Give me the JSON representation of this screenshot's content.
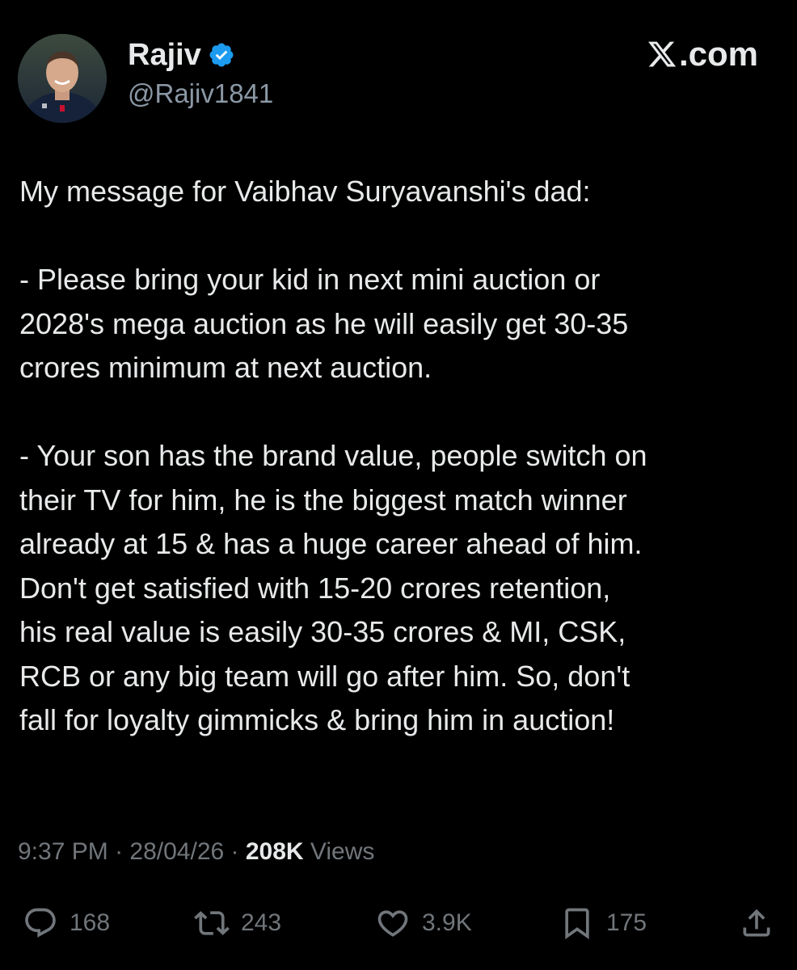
{
  "author": {
    "display_name": "Rajiv",
    "handle": "@Rajiv1841",
    "verified": true
  },
  "brand": {
    "label": ".com"
  },
  "tweet": {
    "text": "My message for Vaibhav Suryavanshi's dad:\n\n- Please bring your kid in next mini auction or\n2028's mega auction as he will easily get 30-35\ncrores minimum at next auction.\n\n- Your son has the brand value, people switch on\ntheir TV for him, he is the biggest match winner\nalready at 15 & has a huge career ahead of him.\nDon't get satisfied with 15-20 crores retention,\nhis real value is easily 30-35 crores & MI, CSK,\nRCB or any big team will go after him. So, don't\nfall for loyalty gimmicks & bring him in auction!"
  },
  "meta": {
    "time": "9:37 PM",
    "separator": " · ",
    "date": "28/04/26",
    "views_count": "208K",
    "views_label": " Views"
  },
  "actions": {
    "replies": "168",
    "reposts": "243",
    "likes": "3.9K",
    "bookmarks": "175"
  },
  "colors": {
    "background": "#000000",
    "text": "#e7e9ea",
    "secondary": "#71767b",
    "verified": "#1d9bf0"
  }
}
